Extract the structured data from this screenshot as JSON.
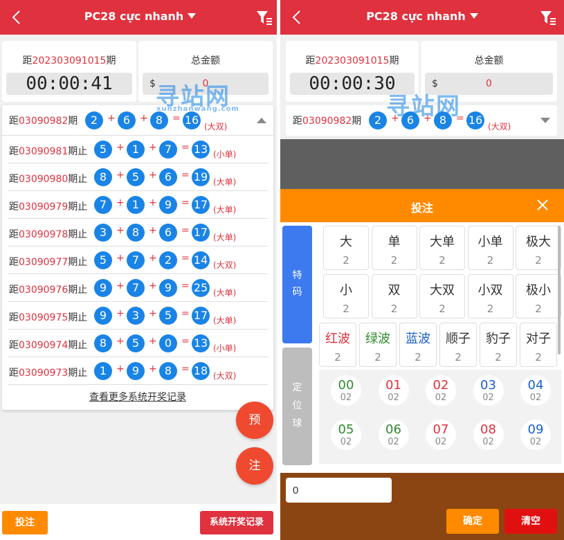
{
  "header": {
    "title": "PC28 cực nhanh"
  },
  "info": {
    "period_prefix": "距",
    "period_number": "202303091015",
    "period_suffix": "期",
    "total_label": "总金额",
    "currency": "$",
    "left_timer": "00:00:41",
    "right_timer": "00:00:30",
    "left_amount": "0",
    "right_amount": "0"
  },
  "draws": [
    {
      "label_prefix": "距",
      "period": "03090982",
      "label_suffix": "期",
      "a": "2",
      "b": "6",
      "c": "8",
      "sum": "16",
      "result": "(大双)"
    },
    {
      "label_prefix": "距",
      "period": "03090981",
      "label_suffix": "期止",
      "a": "5",
      "b": "1",
      "c": "7",
      "sum": "13",
      "result": "(小单)"
    },
    {
      "label_prefix": "距",
      "period": "03090980",
      "label_suffix": "期止",
      "a": "8",
      "b": "5",
      "c": "6",
      "sum": "19",
      "result": "(大单)"
    },
    {
      "label_prefix": "距",
      "period": "03090979",
      "label_suffix": "期止",
      "a": "7",
      "b": "1",
      "c": "9",
      "sum": "17",
      "result": "(大单)"
    },
    {
      "label_prefix": "距",
      "period": "03090978",
      "label_suffix": "期止",
      "a": "3",
      "b": "8",
      "c": "6",
      "sum": "17",
      "result": "(大单)"
    },
    {
      "label_prefix": "距",
      "period": "03090977",
      "label_suffix": "期止",
      "a": "5",
      "b": "7",
      "c": "2",
      "sum": "14",
      "result": "(大双)"
    },
    {
      "label_prefix": "距",
      "period": "03090976",
      "label_suffix": "期止",
      "a": "9",
      "b": "7",
      "c": "9",
      "sum": "25",
      "result": "(大单)"
    },
    {
      "label_prefix": "距",
      "period": "03090975",
      "label_suffix": "期止",
      "a": "9",
      "b": "3",
      "c": "5",
      "sum": "17",
      "result": "(大单)"
    },
    {
      "label_prefix": "距",
      "period": "03090974",
      "label_suffix": "期止",
      "a": "8",
      "b": "5",
      "c": "0",
      "sum": "13",
      "result": "(小单)"
    },
    {
      "label_prefix": "距",
      "period": "03090973",
      "label_suffix": "期止",
      "a": "1",
      "b": "9",
      "c": "8",
      "sum": "18",
      "result": "(大双)"
    }
  ],
  "ops": {
    "plus": "+",
    "equals": "="
  },
  "more_link": "查看更多系统开奖记录",
  "fabs": {
    "preview": "预",
    "bet": "注"
  },
  "bottom": {
    "bet": "投注",
    "history": "系统开奖记录"
  },
  "watermark": {
    "big": "寻站网",
    "small": "xunzhanwang.com"
  },
  "betpanel": {
    "title": "投注",
    "tab_special": "特\n码",
    "tab_position": "定\n位\n球",
    "cells_row1": [
      {
        "name": "大",
        "odds": "2"
      },
      {
        "name": "单",
        "odds": "2"
      },
      {
        "name": "大单",
        "odds": "2"
      },
      {
        "name": "小单",
        "odds": "2"
      },
      {
        "name": "极大",
        "odds": "2"
      }
    ],
    "cells_row2": [
      {
        "name": "小",
        "odds": "2"
      },
      {
        "name": "双",
        "odds": "2"
      },
      {
        "name": "大双",
        "odds": "2"
      },
      {
        "name": "小双",
        "odds": "2"
      },
      {
        "name": "极小",
        "odds": "2"
      }
    ],
    "cells_row3": [
      {
        "name": "红波",
        "odds": "2",
        "color": "red"
      },
      {
        "name": "绿波",
        "odds": "2",
        "color": "green"
      },
      {
        "name": "蓝波",
        "odds": "2",
        "color": "blue"
      },
      {
        "name": "顺子",
        "odds": "2"
      },
      {
        "name": "豹子",
        "odds": "2"
      },
      {
        "name": "对子",
        "odds": "2"
      }
    ],
    "numbers": [
      {
        "num": "00",
        "odds": "02",
        "color": "green"
      },
      {
        "num": "01",
        "odds": "02",
        "color": "red"
      },
      {
        "num": "02",
        "odds": "02",
        "color": "red"
      },
      {
        "num": "03",
        "odds": "02",
        "color": "blue"
      },
      {
        "num": "04",
        "odds": "02",
        "color": "blue"
      },
      {
        "num": "05",
        "odds": "02",
        "color": "green"
      },
      {
        "num": "06",
        "odds": "02",
        "color": "green"
      },
      {
        "num": "07",
        "odds": "02",
        "color": "red"
      },
      {
        "num": "08",
        "odds": "02",
        "color": "red"
      },
      {
        "num": "09",
        "odds": "02",
        "color": "blue"
      }
    ],
    "amount_value": "0",
    "confirm": "确定",
    "clear": "清空"
  },
  "colors": {
    "brand_red": "#e0313e",
    "orange": "#ff8a00",
    "ball_blue": "#1a84e6",
    "footer_brown": "#8b4513"
  }
}
